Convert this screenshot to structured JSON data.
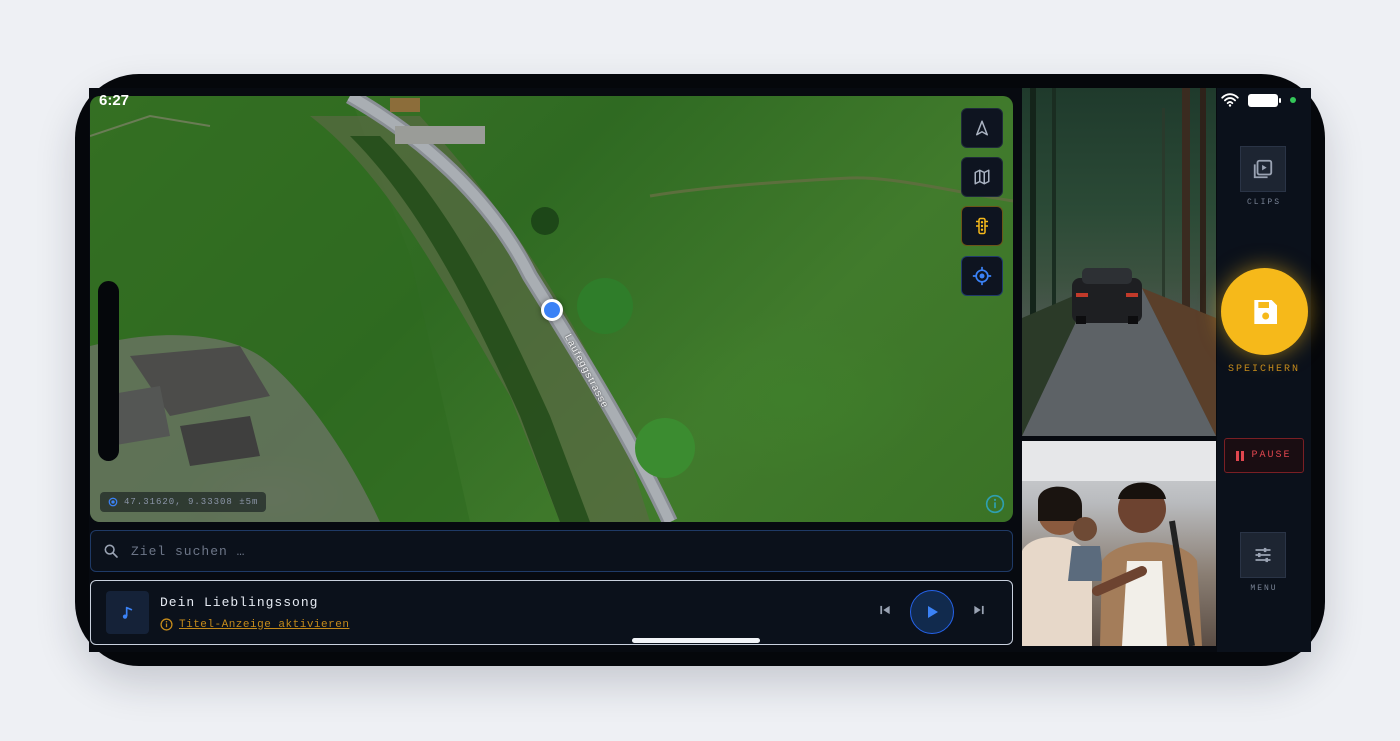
{
  "status_bar": {
    "time": "6:27"
  },
  "map": {
    "street_label": "Laufeggstrasse",
    "coordinates": "47.31620, 9.33308  ±5m",
    "controls": [
      "navigate-arrow-icon",
      "map-layers-icon",
      "traffic-light-icon",
      "my-location-icon"
    ]
  },
  "search": {
    "placeholder": "Ziel suchen …",
    "value": ""
  },
  "music": {
    "title": "Dein Lieblingssong",
    "hint": "Titel-Anzeige aktivieren"
  },
  "side_panel": {
    "clips_label": "CLIPS",
    "save_label": "SPEICHERN",
    "pause_label": "PAUSE",
    "menu_label": "MENU"
  },
  "colors": {
    "accent": "#f6b91a",
    "primary_blue": "#3b82f6",
    "danger": "#e0464f",
    "background": "#0b111b"
  }
}
